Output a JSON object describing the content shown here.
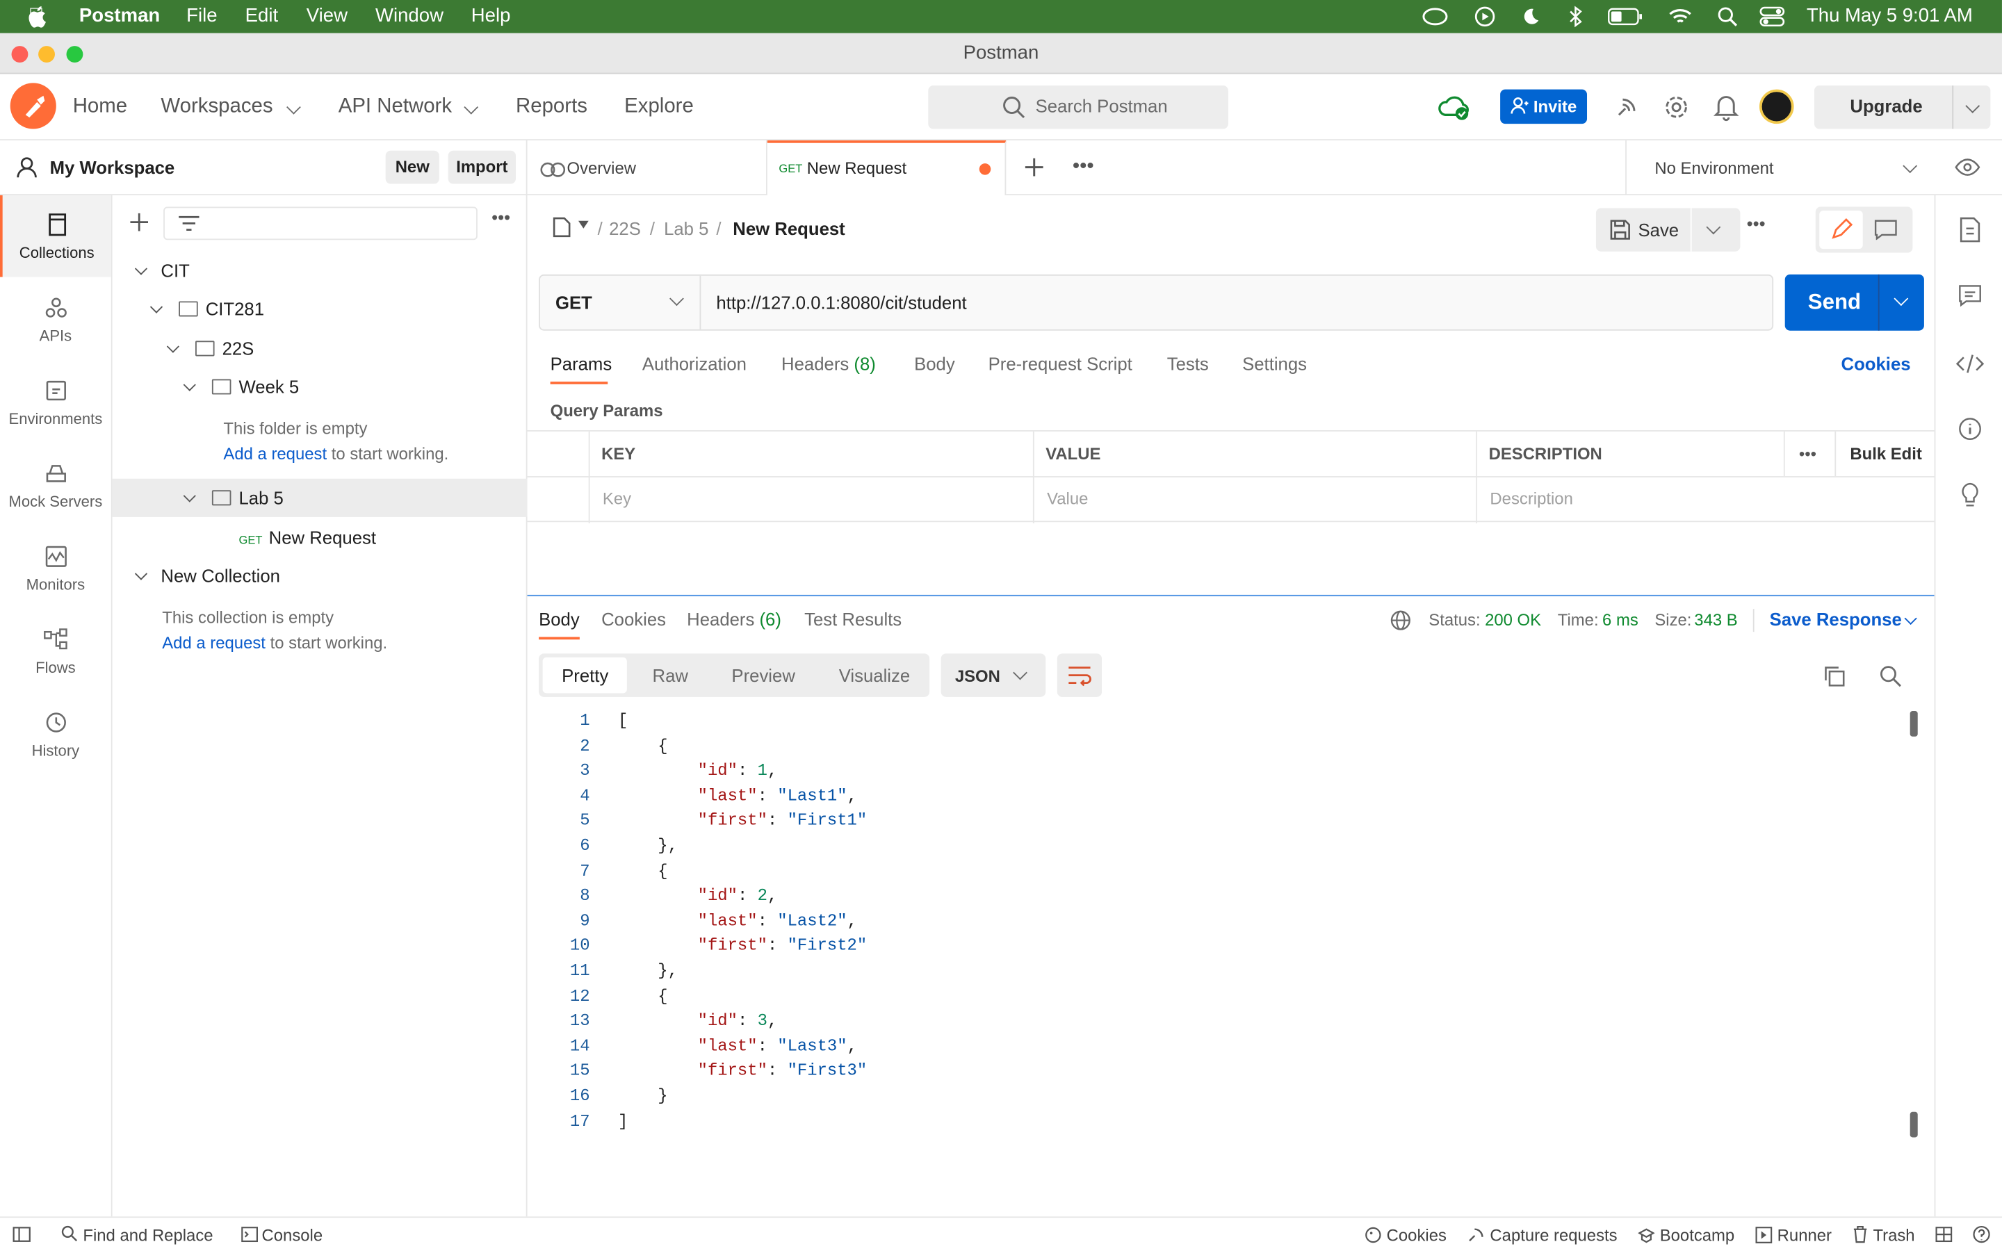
{
  "menubar": {
    "app": "Postman",
    "items": [
      "File",
      "Edit",
      "View",
      "Window",
      "Help"
    ],
    "datetime": "Thu May 5  9:01 AM"
  },
  "window": {
    "title": "Postman"
  },
  "header": {
    "home": "Home",
    "workspaces": "Workspaces",
    "api_network": "API Network",
    "reports": "Reports",
    "explore": "Explore",
    "search_placeholder": "Search Postman",
    "invite": "Invite",
    "upgrade": "Upgrade"
  },
  "workspace": {
    "name": "My Workspace",
    "new": "New",
    "import": "Import"
  },
  "rail": [
    "Collections",
    "APIs",
    "Environments",
    "Mock Servers",
    "Monitors",
    "Flows",
    "History"
  ],
  "tree": {
    "cit": "CIT",
    "cit281": "CIT281",
    "t22s": "22S",
    "week5": "Week 5",
    "empty_folder": "This folder is empty",
    "add_request": "Add a request",
    "to_start": "to start working.",
    "lab5": "Lab 5",
    "req_method": "GET",
    "req_name": "New Request",
    "new_collection": "New Collection",
    "empty_collection": "This collection is empty"
  },
  "tabs": {
    "overview": "Overview",
    "active_method": "GET",
    "active": "New Request",
    "environment": "No Environment"
  },
  "breadcrumb": {
    "p1": "22S",
    "p2": "Lab 5",
    "current": "New Request",
    "save": "Save"
  },
  "request": {
    "method": "GET",
    "url": "http://127.0.0.1:8080/cit/student",
    "send": "Send"
  },
  "req_tabs": {
    "params": "Params",
    "authorization": "Authorization",
    "headers": "Headers",
    "headers_count": "(8)",
    "body": "Body",
    "prerequest": "Pre-request Script",
    "tests": "Tests",
    "settings": "Settings",
    "cookies": "Cookies"
  },
  "params": {
    "title": "Query Params",
    "key": "KEY",
    "value": "VALUE",
    "description": "DESCRIPTION",
    "bulk_edit": "Bulk Edit",
    "key_ph": "Key",
    "value_ph": "Value",
    "desc_ph": "Description"
  },
  "response": {
    "body": "Body",
    "cookies": "Cookies",
    "headers": "Headers",
    "headers_count": "(6)",
    "test_results": "Test Results",
    "status_label": "Status:",
    "status": "200 OK",
    "time_label": "Time:",
    "time": "6 ms",
    "size_label": "Size:",
    "size": "343 B",
    "save_response": "Save Response",
    "views": [
      "Pretty",
      "Raw",
      "Preview",
      "Visualize"
    ],
    "format": "JSON"
  },
  "code_lines": [
    {
      "n": "1",
      "t": "["
    },
    {
      "n": "2",
      "t": "    {"
    },
    {
      "n": "3",
      "t": "        \"id\": 1,"
    },
    {
      "n": "4",
      "t": "        \"last\": \"Last1\","
    },
    {
      "n": "5",
      "t": "        \"first\": \"First1\""
    },
    {
      "n": "6",
      "t": "    },"
    },
    {
      "n": "7",
      "t": "    {"
    },
    {
      "n": "8",
      "t": "        \"id\": 2,"
    },
    {
      "n": "9",
      "t": "        \"last\": \"Last2\","
    },
    {
      "n": "10",
      "t": "        \"first\": \"First2\""
    },
    {
      "n": "11",
      "t": "    },"
    },
    {
      "n": "12",
      "t": "    {"
    },
    {
      "n": "13",
      "t": "        \"id\": 3,"
    },
    {
      "n": "14",
      "t": "        \"last\": \"Last3\","
    },
    {
      "n": "15",
      "t": "        \"first\": \"First3\""
    },
    {
      "n": "16",
      "t": "    }"
    },
    {
      "n": "17",
      "t": "]"
    }
  ],
  "statusbar": {
    "find": "Find and Replace",
    "console": "Console",
    "cookies": "Cookies",
    "capture": "Capture requests",
    "bootcamp": "Bootcamp",
    "runner": "Runner",
    "trash": "Trash"
  },
  "colors": {
    "menubar": "#3c7a33",
    "accent": "#ff6c37",
    "send": "#0265d2",
    "link": "#0b5ccc",
    "ok": "#0f8a2f"
  }
}
